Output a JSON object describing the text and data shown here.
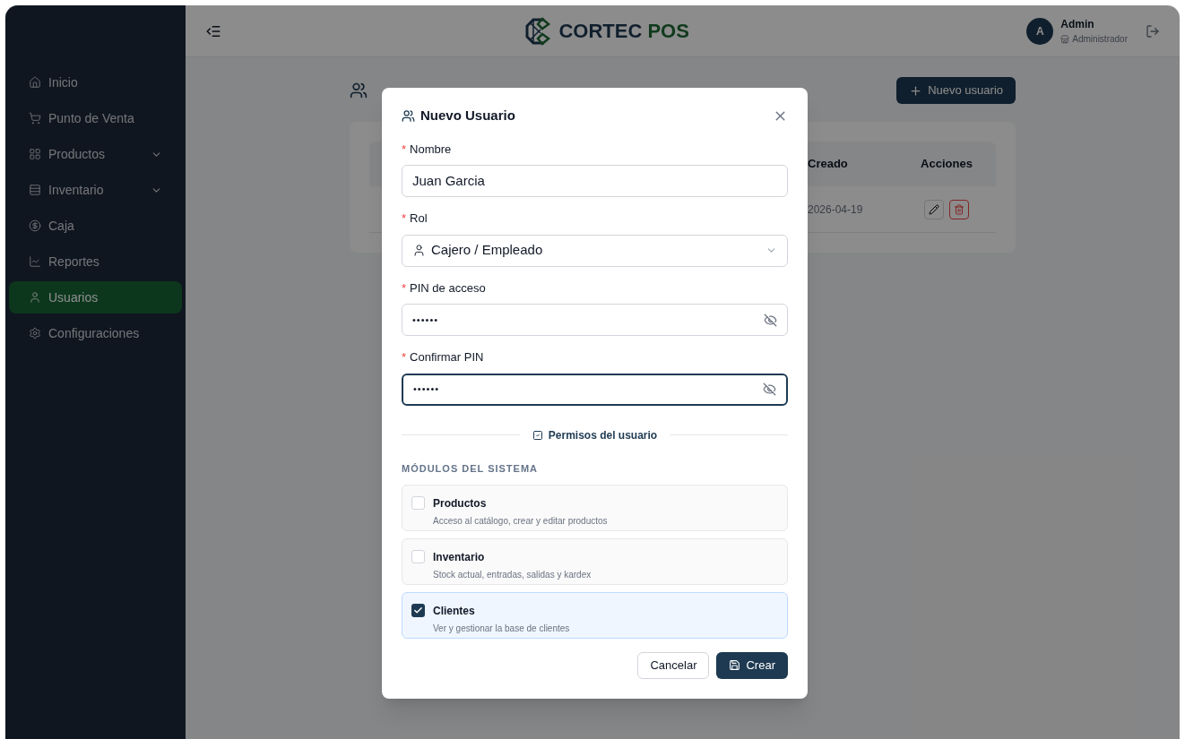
{
  "header": {
    "brand": {
      "first": "CORTEC",
      "second": "POS"
    },
    "user": {
      "initial": "A",
      "name": "Admin",
      "role": "Administrador"
    }
  },
  "sidebar": {
    "items": [
      {
        "label": "Inicio",
        "selected": false,
        "expandable": false
      },
      {
        "label": "Punto de Venta",
        "selected": false,
        "expandable": false
      },
      {
        "label": "Productos",
        "selected": false,
        "expandable": true
      },
      {
        "label": "Inventario",
        "selected": false,
        "expandable": true
      },
      {
        "label": "Caja",
        "selected": false,
        "expandable": false
      },
      {
        "label": "Reportes",
        "selected": false,
        "expandable": false
      },
      {
        "label": "Usuarios",
        "selected": true,
        "expandable": false
      },
      {
        "label": "Configuraciones",
        "selected": false,
        "expandable": false
      }
    ]
  },
  "page": {
    "new_button": "Nuevo usuario",
    "table": {
      "columns": [
        "Creado",
        "Acciones"
      ],
      "rows": [
        {
          "created": "2026-04-19"
        }
      ]
    }
  },
  "modal": {
    "title": "Nuevo Usuario",
    "fields": [
      {
        "kind": "text",
        "label": "Nombre",
        "required_mark": "*",
        "value": "Juan Garcia",
        "focused": false
      },
      {
        "kind": "select",
        "label": "Rol",
        "required_mark": "*",
        "value": "Cajero / Empleado",
        "focused": false
      },
      {
        "kind": "password",
        "label": "PIN de acceso",
        "required_mark": "*",
        "value": "••••••",
        "focused": false
      },
      {
        "kind": "password",
        "label": "Confirmar PIN",
        "required_mark": "*",
        "value": "••••••",
        "focused": true
      }
    ],
    "permissions_title": "Permisos del usuario",
    "section": "MÓDULOS DEL SISTEMA",
    "modules": [
      {
        "name": "Productos",
        "description": "Acceso al catálogo, crear y editar productos",
        "checked": false
      },
      {
        "name": "Inventario",
        "description": "Stock actual, entradas, salidas y kardex",
        "checked": false
      },
      {
        "name": "Clientes",
        "description": "Ver y gestionar la base de clientes",
        "checked": true
      }
    ],
    "buttons": {
      "cancel": "Cancelar",
      "submit": "Crear"
    }
  }
}
